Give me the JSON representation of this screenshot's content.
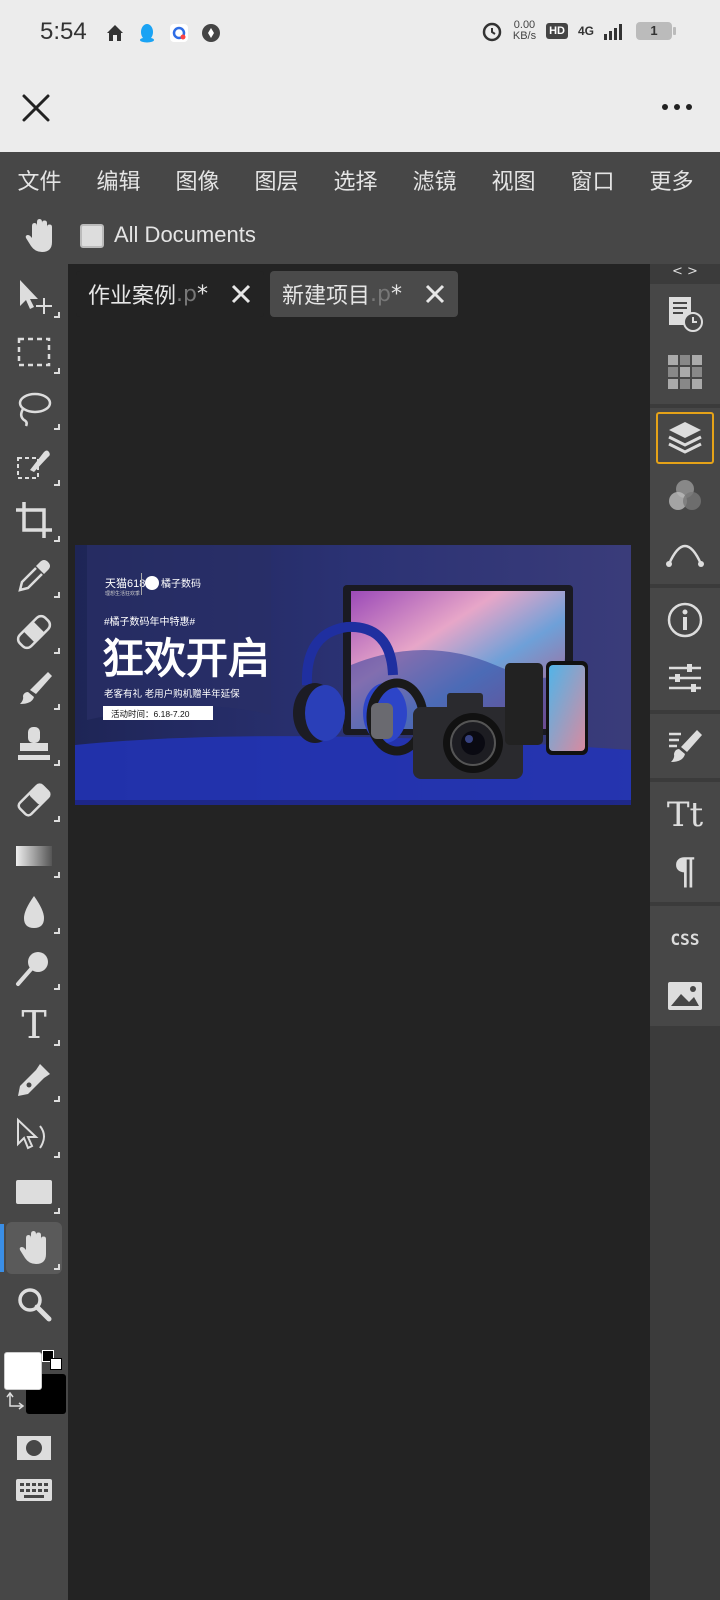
{
  "status_bar": {
    "time": "5:54",
    "speed_value": "0.00",
    "speed_unit": "KB/s",
    "hd": "HD",
    "network": "4G",
    "battery": "1",
    "icons": [
      "home-icon",
      "qq-icon",
      "app-icon",
      "compass-icon",
      "alarm-icon",
      "signal-icon"
    ]
  },
  "app_bar": {
    "close_icon": "close-icon",
    "more_icon": "more-icon"
  },
  "menu": {
    "items": [
      "文件",
      "编辑",
      "图像",
      "图层",
      "选择",
      "滤镜",
      "视图",
      "窗口",
      "更多"
    ]
  },
  "options": {
    "all_documents_label": "All Documents",
    "all_documents_checked": false
  },
  "tabs": [
    {
      "title": "作业案例",
      "ext": ".p",
      "modified": " *"
    },
    {
      "title": "新建项目",
      "ext": ".p",
      "modified": " *"
    }
  ],
  "banner": {
    "logo_tmall": "天猫618",
    "logo_sub": "理想生活狂欢季",
    "logo_brand": "橘子数码",
    "hashtag": "#橘子数码年中特惠#",
    "headline": "狂欢开启",
    "subline": "老客有礼  老用户购机赠半年延保",
    "period": "活动时间：6.18-7.20"
  },
  "tools": [
    "move-tool",
    "marquee-tool",
    "lasso-tool",
    "quick-select-tool",
    "crop-tool",
    "eyedropper-tool",
    "healing-tool",
    "brush-tool",
    "stamp-tool",
    "eraser-tool",
    "gradient-tool",
    "blur-tool",
    "dodge-tool",
    "type-tool",
    "pen-tool",
    "path-select-tool",
    "shape-tool",
    "hand-tool",
    "zoom-tool"
  ],
  "active_tool": "hand-tool",
  "colors": {
    "foreground": "#ffffff",
    "background": "#000000",
    "accent_active": "#3a8ee6",
    "panel_selected": "#e5a218"
  },
  "right_panel": {
    "toggle_label": "< >",
    "buttons": [
      "history-panel",
      "swatches-panel",
      "layers-panel",
      "channels-panel",
      "paths-panel",
      "info-panel",
      "adjustments-panel",
      "brush-settings-panel",
      "character-panel",
      "paragraph-panel",
      "css-panel",
      "image-panel"
    ],
    "selected": "layers-panel",
    "css_label": "CSS",
    "character_label": "Tt",
    "paragraph_label": "¶"
  }
}
